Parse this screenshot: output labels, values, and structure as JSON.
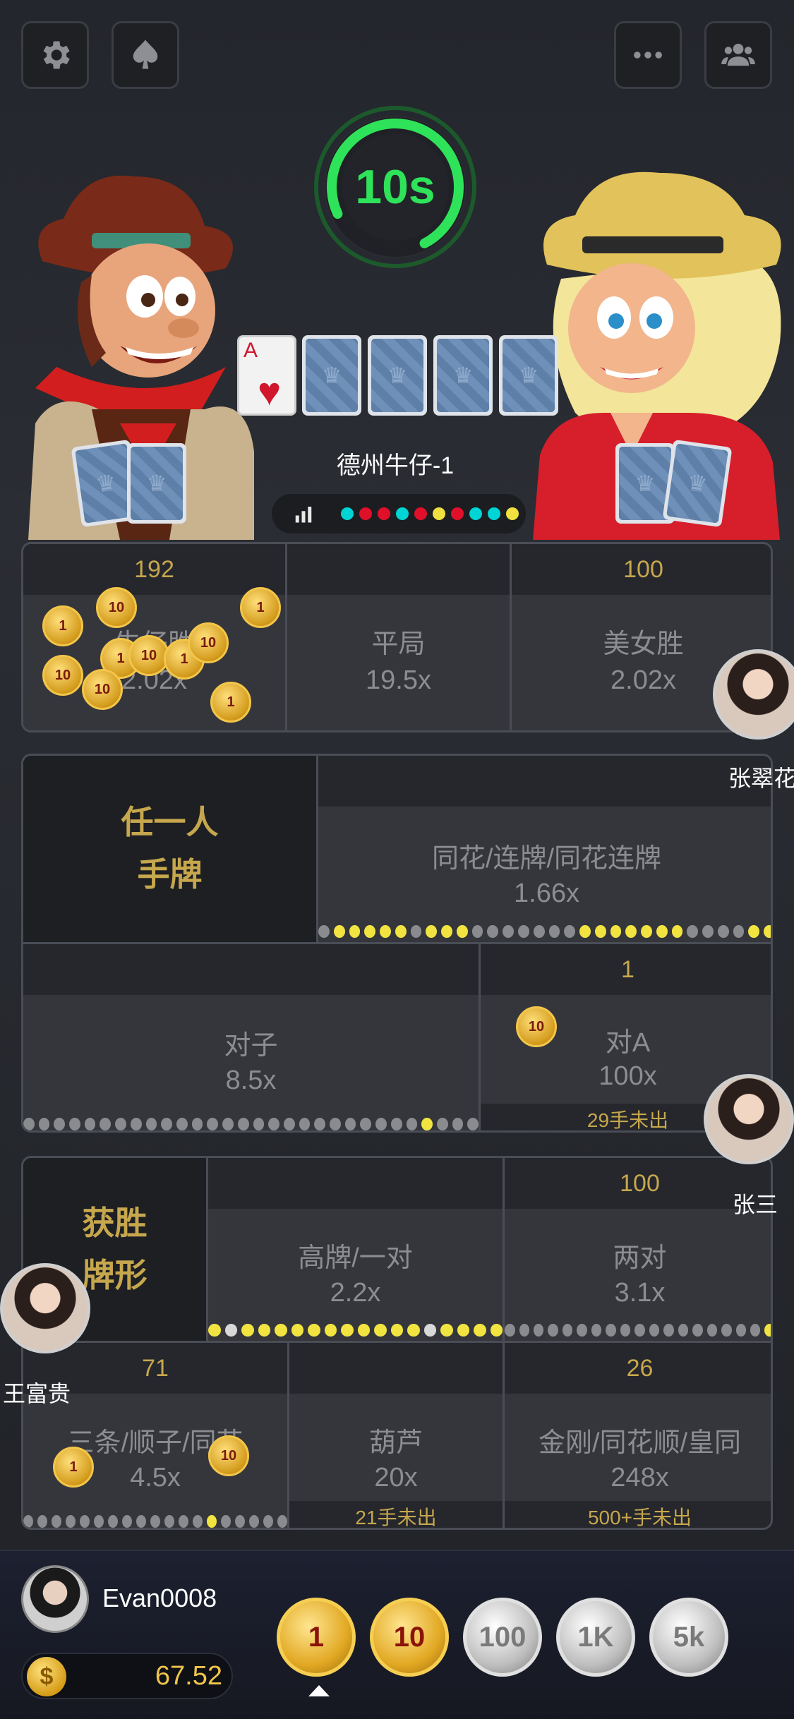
{
  "top_bar": {
    "settings_icon": "gear-icon",
    "suit_icon": "spade-icon",
    "more_icon": "ellipsis-icon",
    "players_icon": "group-icon"
  },
  "timer": {
    "label": "10s",
    "color": "#2ee35a"
  },
  "community_cards": {
    "face_up": {
      "rank": "A",
      "suit": "♥"
    },
    "face_down_count": 4
  },
  "table": {
    "name": "德州牛仔-1",
    "history_icon": "bar-chart-icon",
    "history_dots": [
      "#00d4d4",
      "#e0102a",
      "#e0102a",
      "#00d4d4",
      "#e0102a",
      "#f0e040",
      "#e0102a",
      "#00d4d4",
      "#00d4d4",
      "#f0e040"
    ]
  },
  "winner_bets": [
    {
      "amount": "192",
      "name": "牛仔胜",
      "odds": "2.02x"
    },
    {
      "amount": "",
      "name": "平局",
      "odds": "19.5x"
    },
    {
      "amount": "100",
      "name": "美女胜",
      "odds": "2.02x"
    }
  ],
  "hand_section": {
    "label_line1": "任一人",
    "label_line2": "手牌",
    "flush_straight": {
      "amount": "",
      "name": "同花/连牌/同花连牌",
      "odds": "1.66x"
    },
    "pair": {
      "amount": "",
      "name": "对子",
      "odds": "8.5x"
    },
    "pair_a": {
      "amount": "1",
      "name": "对A",
      "odds": "100x",
      "streak": "29手未出"
    }
  },
  "winning_hand": {
    "label_line1": "获胜",
    "label_line2": "牌形",
    "high_pair": {
      "amount": "",
      "name": "高牌/一对",
      "odds": "2.2x"
    },
    "two_pair": {
      "amount": "100",
      "name": "两对",
      "odds": "3.1x"
    },
    "trips_straight_flush": {
      "amount": "71",
      "name": "三条/顺子/同花",
      "odds": "4.5x"
    },
    "full_house": {
      "amount": "",
      "name": "葫芦",
      "odds": "20x",
      "streak": "21手未出"
    },
    "quads_royal": {
      "amount": "26",
      "name": "金刚/同花顺/皇同",
      "odds": "248x",
      "streak": "500+手未出"
    }
  },
  "table_chips": {
    "cowboy": [
      "1",
      "10",
      "1",
      "10",
      "1",
      "10",
      "1",
      "10",
      "10",
      "1"
    ],
    "pair_a": [
      "10"
    ],
    "trips": [
      "1",
      "10"
    ]
  },
  "players": [
    {
      "name": "张翠花"
    },
    {
      "name": "张三"
    },
    {
      "name": "王富贵"
    }
  ],
  "me": {
    "name": "Evan0008",
    "balance": "67.52",
    "coin_symbol": "$"
  },
  "chip_selector": [
    {
      "label": "1",
      "style": "gold"
    },
    {
      "label": "10",
      "style": "gold"
    },
    {
      "label": "100",
      "style": "silver"
    },
    {
      "label": "1K",
      "style": "silver"
    },
    {
      "label": "5k",
      "style": "silver"
    }
  ]
}
